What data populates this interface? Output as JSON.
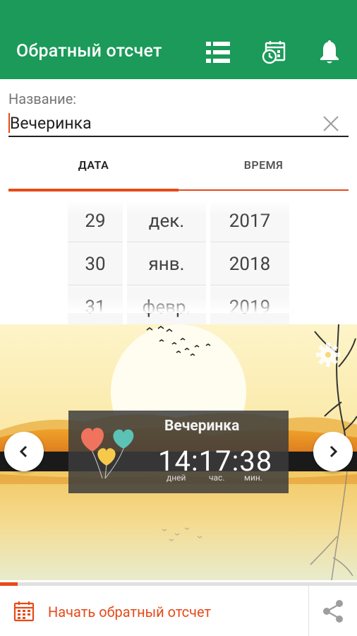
{
  "appbar": {
    "title": "Обратный отсчет",
    "icons": [
      "list-icon",
      "calendar-clock-icon",
      "bell-icon"
    ],
    "color": "#1b9a59"
  },
  "name_field": {
    "label": "Название:",
    "value": "Вечеринка"
  },
  "tabs": [
    {
      "label": "ДАТА",
      "active": true
    },
    {
      "label": "ВРЕМЯ",
      "active": false
    }
  ],
  "picker": {
    "days": [
      "29",
      "30",
      "31"
    ],
    "months": [
      "дек.",
      "янв.",
      "февр."
    ],
    "years": [
      "2017",
      "2018",
      "2019"
    ]
  },
  "countdown": {
    "title": "Вечеринка",
    "time": "14:17:38",
    "units": [
      "дней",
      "час.",
      "мин."
    ]
  },
  "progress": {
    "fraction": 0.05
  },
  "bottom": {
    "start_label": "Начать обратный отсчет",
    "accent": "#e64a19"
  }
}
